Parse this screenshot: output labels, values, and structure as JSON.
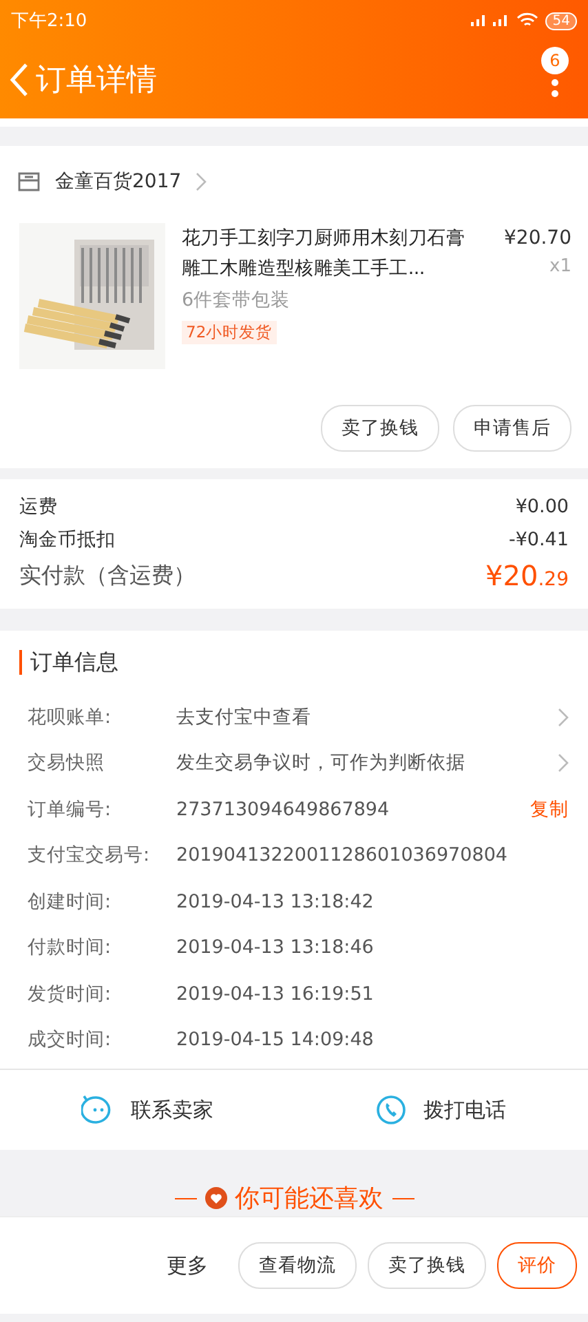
{
  "status_bar": {
    "time": "下午2:10",
    "battery": "54"
  },
  "header": {
    "title": "订单详情",
    "badge": "6"
  },
  "shop": {
    "name": "金童百货2017"
  },
  "item": {
    "kind": "picture",
    "title": "花刀手工刻字刀厨师用木刻刀石膏雕工木雕造型核雕美工手工...",
    "price": "¥20.70",
    "quantity": "x1",
    "sku": "6件套带包装",
    "tag": "72小时发货",
    "actions": [
      "卖了换钱",
      "申请售后"
    ]
  },
  "fees": [
    {
      "label": "运费",
      "value": "¥0.00",
      "kind": "plain"
    },
    {
      "label": "淘金币抵扣",
      "value": "-¥0.41",
      "kind": "plain"
    },
    {
      "label": "实付款（含运费）",
      "value": "¥20.29",
      "kind": "total"
    }
  ],
  "order_info": {
    "title": "订单信息",
    "rows": [
      {
        "label": "花呗账单:",
        "value": "去支付宝中查看",
        "kind": "link"
      },
      {
        "label": "交易快照",
        "value": "发生交易争议时，可作为判断依据",
        "kind": "link"
      },
      {
        "label": "订单编号:",
        "value": "273713094649867894",
        "kind": "copy",
        "action": "复制"
      },
      {
        "label": "支付宝交易号:",
        "value": "2019041322001128601036970804",
        "kind": "plain"
      },
      {
        "label": "创建时间:",
        "value": "2019-04-13 13:18:42",
        "kind": "plain"
      },
      {
        "label": "付款时间:",
        "value": "2019-04-13 13:18:46",
        "kind": "plain"
      },
      {
        "label": "发货时间:",
        "value": "2019-04-13 16:19:51",
        "kind": "plain"
      },
      {
        "label": "成交时间:",
        "value": "2019-04-15 14:09:48",
        "kind": "plain"
      }
    ]
  },
  "contact": [
    {
      "label": "联系卖家",
      "kind": "chat"
    },
    {
      "label": "拨打电话",
      "kind": "phone"
    }
  ],
  "recommend": {
    "title": "你可能还喜欢"
  },
  "bottom_bar": {
    "more": "更多",
    "buttons": [
      {
        "label": "查看物流",
        "highlighted": false
      },
      {
        "label": "卖了换钱",
        "highlighted": false
      },
      {
        "label": "评价",
        "highlighted": true
      }
    ]
  }
}
